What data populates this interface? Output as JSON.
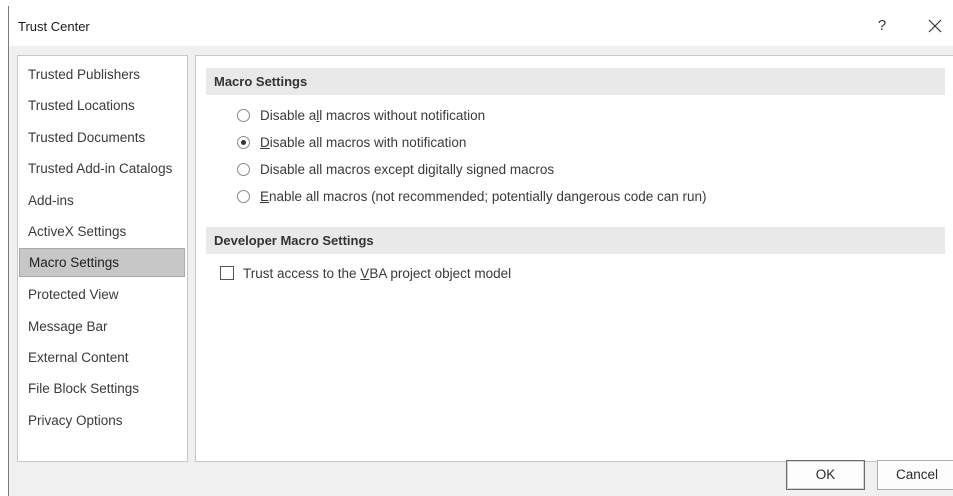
{
  "window": {
    "title": "Trust Center",
    "help_label": "?"
  },
  "nav": {
    "items": [
      {
        "label": "Trusted Publishers"
      },
      {
        "label": "Trusted Locations"
      },
      {
        "label": "Trusted Documents"
      },
      {
        "label": "Trusted Add-in Catalogs"
      },
      {
        "label": "Add-ins"
      },
      {
        "label": "ActiveX Settings"
      },
      {
        "label": "Macro Settings"
      },
      {
        "label": "Protected View"
      },
      {
        "label": "Message Bar"
      },
      {
        "label": "External Content"
      },
      {
        "label": "File Block Settings"
      },
      {
        "label": "Privacy Options"
      }
    ],
    "selected": "Macro Settings"
  },
  "macro_settings": {
    "header": "Macro Settings",
    "options": [
      {
        "pre": "Disable a",
        "ul": "l",
        "post": "l macros without notification",
        "checked": false
      },
      {
        "pre": "",
        "ul": "D",
        "post": "isable all macros with notification",
        "checked": true
      },
      {
        "pre": "Disable all macros except di",
        "ul": "g",
        "post": "itally signed macros",
        "checked": false
      },
      {
        "pre": "",
        "ul": "E",
        "post": "nable all macros (not recommended; potentially dangerous code can run)",
        "checked": false
      }
    ]
  },
  "developer_settings": {
    "header": "Developer Macro Settings",
    "trust_vba": {
      "pre": "Trust access to the ",
      "ul": "V",
      "post": "BA project object model",
      "checked": false
    }
  },
  "buttons": {
    "ok": "OK",
    "cancel": "Cancel"
  }
}
